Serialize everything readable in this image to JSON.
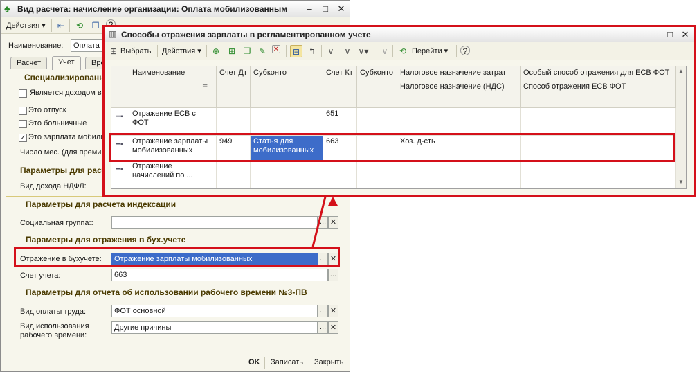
{
  "back_window": {
    "title": "Вид расчета: начисление организации: Оплата мобилизованным",
    "toolbar": {
      "actions_label": "Действия",
      "help_glyph": "?"
    },
    "name_label": "Наименование:",
    "name_value": "Оплата м",
    "tabs": [
      "Расчет",
      "Учет",
      "Вре"
    ],
    "special_section_title": "Специализированн",
    "checkboxes": [
      {
        "label": "Является доходом в",
        "checked": false
      },
      {
        "label": "Это отпуск",
        "checked": false
      },
      {
        "label": "Это больничные",
        "checked": false
      },
      {
        "label": "Это зарплата мобили",
        "checked": true
      }
    ],
    "months_label": "Число мес. (для премии",
    "params_section_title": "Параметры для расче",
    "ndfl_label": "Вид дохода НДФЛ:",
    "index_section_title": "Параметры для расчета индексации",
    "social_group_label": "Социальная группа::",
    "social_group_value": "",
    "accounting_section_title": "Параметры для отражения в бух.учете",
    "reflection_label": "Отражение в бухучете:",
    "reflection_value": "Отражение зарплаты мобилизованных",
    "account_label": "Счет учета:",
    "account_value": "663",
    "report_section_title": "Параметры для отчета об использовании рабочего времени №3-ПВ",
    "pay_type_label": "Вид оплаты труда:",
    "pay_type_value": "ФОТ основной",
    "worktime_label": "Вид использования\nрабочего времени:",
    "worktime_value": "Другие причины",
    "footer": {
      "ok": "OK",
      "save": "Записать",
      "close": "Закрыть"
    },
    "ellipsis": "...",
    "clear": "✕"
  },
  "front_window": {
    "title": "Способы отражения зарплаты в регламентированном учете",
    "toolbar": {
      "select_label": "Выбрать",
      "actions_label": "Действия",
      "goto_label": "Перейти",
      "help_glyph": "?"
    },
    "columns": {
      "name": "Наименование",
      "debit": "Счет Дт",
      "subconto_dt": "Субконто",
      "credit": "Счет Кт",
      "subconto_kt": "Субконто",
      "tax_purpose": "Налоговое назначение затрат",
      "tax_purpose_vat": "Налоговое назначение (НДС)",
      "esv_special": "Особый способ отражения для ЕСВ ФОТ",
      "esv_method": "Способ отражения ЕСВ ФОТ"
    },
    "rows": [
      {
        "name": "Отражение ЕСВ с ФОТ",
        "debit": "",
        "subconto_dt": "",
        "credit": "651",
        "subconto_kt": "",
        "tax_purpose": "",
        "esv": ""
      },
      {
        "name": "Отражение зарплаты мобилизованных",
        "debit": "949",
        "subconto_dt": "Статья для мобилизованных",
        "credit": "663",
        "subconto_kt": "",
        "tax_purpose": "Хоз. д-сть",
        "esv": ""
      },
      {
        "name": "Отражение начислений по ...",
        "debit": "",
        "subconto_dt": "",
        "credit": "",
        "subconto_kt": "",
        "tax_purpose": "",
        "esv": ""
      }
    ]
  },
  "colors": {
    "highlight_red": "#d4101a",
    "selection_blue": "#3d6cc9",
    "section_text": "#4a3a00"
  }
}
